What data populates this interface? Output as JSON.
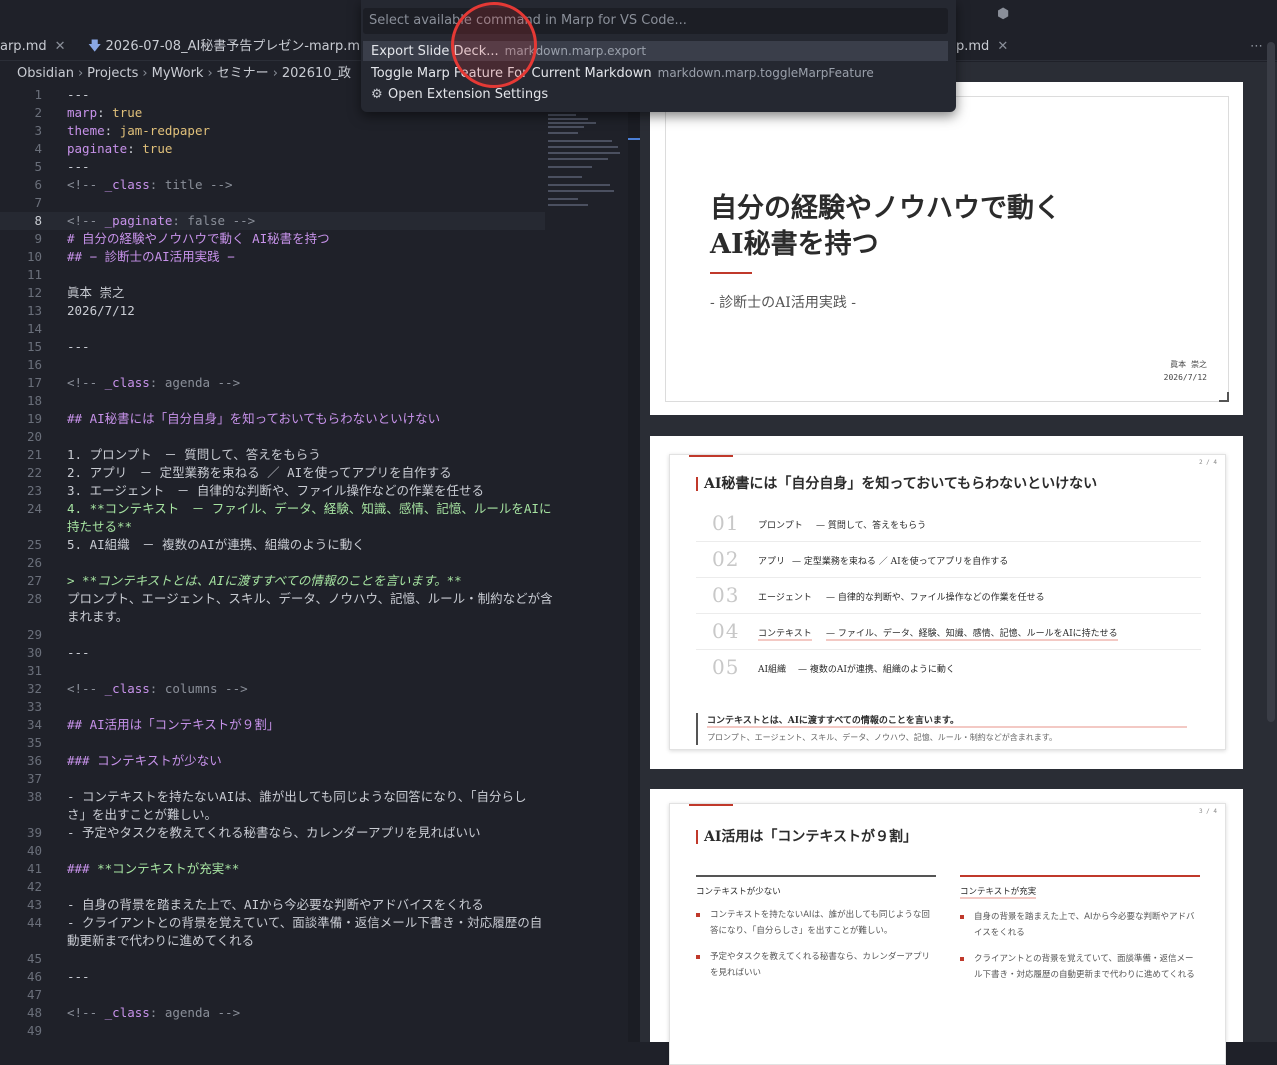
{
  "palette": {
    "placeholder": "Select available command in Marp for VS Code...",
    "items": [
      {
        "label": "Export Slide Deck...",
        "id": "markdown.marp.export"
      },
      {
        "label": "Toggle Marp Feature For Current Markdown",
        "id": "markdown.marp.toggleMarpFeature"
      },
      {
        "label": "Open Extension Settings",
        "id": ""
      }
    ]
  },
  "tabs": [
    {
      "label": "arp.md"
    },
    {
      "label": "2026-07-08_AI秘書予告プレゼン-marp.m"
    },
    {
      "label": "p.md"
    }
  ],
  "breadcrumb": [
    "Obsidian",
    "Projects",
    "MyWork",
    "セミナー",
    "202610_政"
  ],
  "editor": {
    "lines": [
      {
        "n": "1",
        "t": "---"
      },
      {
        "n": "2",
        "k": "marp",
        "v": "true"
      },
      {
        "n": "3",
        "k": "theme",
        "v": "jam-redpaper"
      },
      {
        "n": "4",
        "k": "paginate",
        "v": "true"
      },
      {
        "n": "5",
        "t": "---"
      },
      {
        "n": "6",
        "c1": "<!-- ",
        "ck": "_class",
        "cv": ": title -->"
      },
      {
        "n": "7",
        "t": ""
      },
      {
        "n": "8",
        "c1": "<!-- ",
        "ck": "_paginate",
        "cv": ": false -->"
      },
      {
        "n": "9",
        "h": "# 自分の経験やノウハウで動く AI秘書を持つ"
      },
      {
        "n": "10",
        "h": "## − 診断士のAI活用実践 −"
      },
      {
        "n": "11",
        "t": ""
      },
      {
        "n": "12",
        "t": "眞本 崇之"
      },
      {
        "n": "13",
        "t": "2026/7/12"
      },
      {
        "n": "14",
        "t": ""
      },
      {
        "n": "15",
        "t": "---"
      },
      {
        "n": "16",
        "t": ""
      },
      {
        "n": "17",
        "c1": "<!-- ",
        "ck": "_class",
        "cv": ": agenda -->"
      },
      {
        "n": "18",
        "t": ""
      },
      {
        "n": "19",
        "h": "## AI秘書には「自分自身」を知っておいてもらわないといけない"
      },
      {
        "n": "20",
        "t": ""
      },
      {
        "n": "21",
        "t": "1. プロンプト　－ 質問して、答えをもらう"
      },
      {
        "n": "22",
        "t": "2. アプリ　－ 定型業務を束ねる ／ AIを使ってアプリを自作する"
      },
      {
        "n": "23",
        "t": "3. エージェント　－ 自律的な判断や、ファイル操作などの作業を任せる"
      },
      {
        "n": "24",
        "b": "4. **コンテキスト　－ ファイル、データ、経験、知識、感情、記憶、ルールをAIに"
      },
      {
        "n": "",
        "b": "持たせる**"
      },
      {
        "n": "25",
        "t": "5. AI組織　－ 複数のAIが連携、組織のように動く"
      },
      {
        "n": "26",
        "t": ""
      },
      {
        "n": "27",
        "q": "> **コンテキストとは、AIに渡すすべての情報のことを言います。**"
      },
      {
        "n": "28",
        "t": "プロンプト、エージェント、スキル、データ、ノウハウ、記憶、ルール・制約などが含"
      },
      {
        "n": "",
        "t": "まれます。"
      },
      {
        "n": "29",
        "t": ""
      },
      {
        "n": "30",
        "t": "---"
      },
      {
        "n": "31",
        "t": ""
      },
      {
        "n": "32",
        "c1": "<!-- ",
        "ck": "_class",
        "cv": ": columns -->"
      },
      {
        "n": "33",
        "t": ""
      },
      {
        "n": "34",
        "h": "## AI活用は「コンテキストが９割」"
      },
      {
        "n": "35",
        "t": ""
      },
      {
        "n": "36",
        "h": "### コンテキストが少ない"
      },
      {
        "n": "37",
        "t": ""
      },
      {
        "n": "38",
        "t": "- コンテキストを持たないAIは、誰が出しても同じような回答になり、「自分らし"
      },
      {
        "n": "",
        "t": "さ」を出すことが難しい。"
      },
      {
        "n": "39",
        "t": "- 予定やタスクを教えてくれる秘書なら、カレンダーアプリを見ればいい"
      },
      {
        "n": "40",
        "t": ""
      },
      {
        "n": "41",
        "h": "### ",
        "hb": "**コンテキストが充実**"
      },
      {
        "n": "42",
        "t": ""
      },
      {
        "n": "43",
        "t": "- 自身の背景を踏まえた上で、AIから今必要な判断やアドバイスをくれる"
      },
      {
        "n": "44",
        "t": "- クライアントとの背景を覚えていて、面談準備・返信メール下書き・対応履歴の自"
      },
      {
        "n": "",
        "t": "動更新まで代わりに進めてくれる"
      },
      {
        "n": "45",
        "t": ""
      },
      {
        "n": "46",
        "t": "---"
      },
      {
        "n": "47",
        "t": ""
      },
      {
        "n": "48",
        "c1": "<!-- ",
        "ck": "_class",
        "cv": ": agenda -->"
      },
      {
        "n": "49",
        "t": ""
      }
    ]
  },
  "slide1": {
    "title1": "自分の経験やノウハウで動く",
    "title2": "AI秘書を持つ",
    "subtitle": "- 診断士のAI活用実践 -",
    "author": "眞本 崇之",
    "date": "2026/7/12"
  },
  "slide2": {
    "pageno": "2 / 4",
    "title": "AI秘書には「自分自身」を知っておいてもらわないといけない",
    "items": [
      {
        "num": "01",
        "label": "プロンプト",
        "desc": "— 質問して、答えをもらう"
      },
      {
        "num": "02",
        "label": "アプリ",
        "desc": "— 定型業務を束ねる ／ AIを使ってアプリを自作する"
      },
      {
        "num": "03",
        "label": "エージェント",
        "desc": "— 自律的な判断や、ファイル操作などの作業を任せる"
      },
      {
        "num": "04",
        "label": "コンテキスト",
        "desc": "— ファイル、データ、経験、知識、感情、記憶、ルールをAIに持たせる"
      },
      {
        "num": "05",
        "label": "AI組織",
        "desc": "— 複数のAIが連携、組織のように動く"
      }
    ],
    "quote_main": "コンテキストとは、AIに渡すすべての情報のことを言います。",
    "quote_sub": "プロンプト、エージェント、スキル、データ、ノウハウ、記憶、ルール・制約などが含まれます。"
  },
  "slide3": {
    "pageno": "3 / 4",
    "title": "AI活用は「コンテキストが９割」",
    "left_head": "コンテキストが少ない",
    "left_items": [
      "コンテキストを持たないAIは、誰が出しても同じような回答になり、「自分らしさ」を出すことが難しい。",
      "予定やタスクを教えてくれる秘書なら、カレンダーアプリを見ればいい"
    ],
    "right_head": "コンテキストが充実",
    "right_items": [
      "自身の背景を踏まえた上で、AIから今必要な判断やアドバイスをくれる",
      "クライアントとの背景を覚えていて、面談準備・返信メール下書き・対応履歴の自動更新まで代わりに進めてくれる"
    ]
  }
}
